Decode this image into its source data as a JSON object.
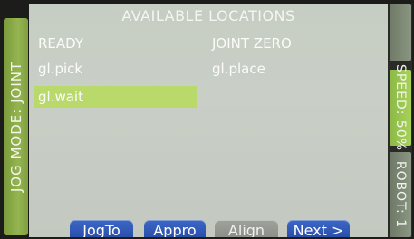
{
  "left_panel": {
    "jog_mode_label": "JOG MODE: JOINT"
  },
  "screen": {
    "title": "AVAILABLE LOCATIONS",
    "locations": [
      {
        "name": "READY"
      },
      {
        "name": "JOINT ZERO"
      },
      {
        "name": "gl.pick"
      },
      {
        "name": "gl.place"
      },
      {
        "name": "gl.wait",
        "selected": true
      }
    ],
    "buttons": {
      "jogto": "JogTo",
      "appro": "Appro",
      "align": "Align",
      "next": "Next >"
    }
  },
  "right_panel": {
    "speed_label": "SPEED: 50%",
    "robot_label": "ROBOT: 1"
  },
  "colors": {
    "selected_row": "#b9d96b",
    "button_blue": "#2f55b3",
    "button_disabled": "#8f948c",
    "strip_green": "#95b551"
  }
}
